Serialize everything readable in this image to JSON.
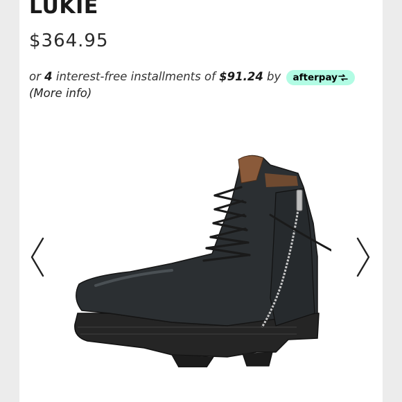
{
  "product": {
    "name": "LUKIE",
    "price": "$364.95"
  },
  "installments": {
    "prefix": "or ",
    "count": "4",
    "middle": " interest-free installments of ",
    "amount": "$91.24",
    "by": " by ",
    "provider": "afterpay",
    "more_info": "(More info)"
  },
  "gallery": {
    "image": "black-leather-lace-up-boot-with-side-zipper",
    "prev_icon": "chevron-left-icon",
    "next_icon": "chevron-right-icon"
  },
  "colors": {
    "afterpay_badge": "#b2fce4",
    "page_background": "#ececec",
    "card_background": "#ffffff"
  }
}
